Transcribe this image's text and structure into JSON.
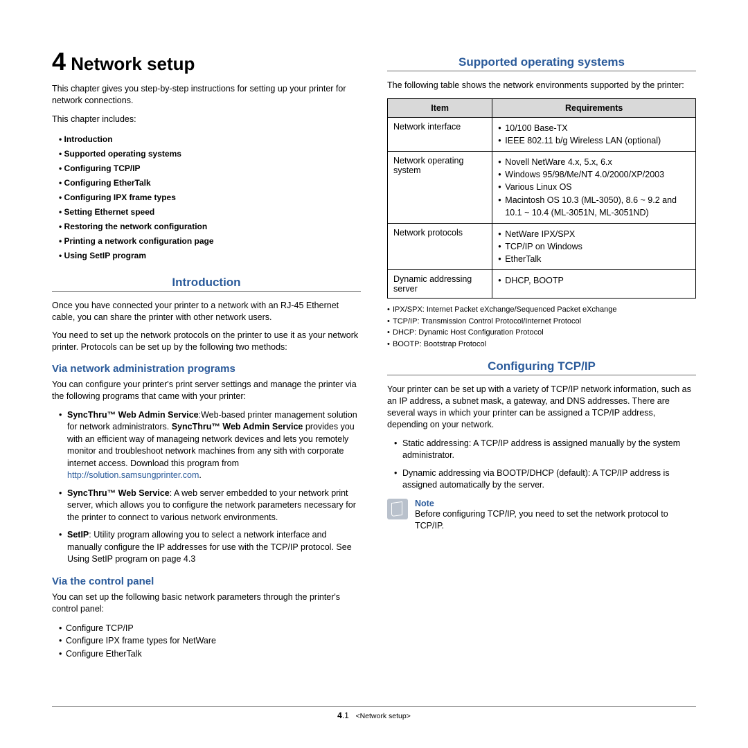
{
  "chapter": {
    "num": "4",
    "title": "Network setup"
  },
  "intro_para": "This chapter gives you step-by-step instructions for setting up your printer for network connections.",
  "includes_label": "This chapter includes:",
  "toc": [
    "Introduction",
    "Supported operating systems",
    "Configuring TCP/IP",
    "Configuring EtherTalk",
    "Configuring IPX frame types",
    "Setting Ethernet speed",
    "Restoring the network configuration",
    "Printing a network configuration page",
    "Using SetIP program"
  ],
  "sec_introduction": {
    "head": "Introduction",
    "p1": "Once you have connected your printer to a network with an RJ-45 Ethernet cable, you can share the printer with other network users.",
    "p2": "You need to set up the network protocols on the printer to use it as your network printer. Protocols can be set up by the following two methods:"
  },
  "sub_admin": {
    "head": "Via network administration programs",
    "intro": "You can configure your printer's print server settings and manage the printer via the following programs that came with your printer:",
    "items": {
      "a_bold1": "SyncThru™ Web Admin Service",
      "a_rest1": ":Web-based printer management solution for network administrators. ",
      "a_bold2": "SyncThru™ Web Admin Service",
      "a_rest2": " provides you with an efficient way of manageing network devices and lets you remotely monitor and troubleshoot network machines from any sith with corporate internet access. Download this program from ",
      "a_link": "http://solution.samsungprinter.com",
      "a_rest3": ".",
      "b_bold": "SyncThru™ Web Service",
      "b_rest": ": A web server embedded to your network print server, which allows you to configure the network parameters necessary for the printer to connect to various network environments.",
      "c_bold": "SetIP",
      "c_rest": ": Utility program allowing you to select a network interface and manually configure the IP addresses for use with the TCP/IP protocol. See Using SetIP program on page 4.3"
    }
  },
  "sub_panel": {
    "head": "Via the control panel",
    "intro": "You can set up the following basic network parameters through the printer's control panel:",
    "items": [
      "Configure TCP/IP",
      "Configure IPX frame types for NetWare",
      "Configure EtherTalk"
    ]
  },
  "sec_supported": {
    "head": "Supported operating systems",
    "intro": "The following table shows the network environments supported by the printer:",
    "th1": "Item",
    "th2": "Requirements",
    "rows": [
      {
        "item": "Network interface",
        "reqs": [
          "10/100 Base-TX",
          "IEEE 802.11 b/g Wireless LAN (optional)"
        ]
      },
      {
        "item": "Network operating system",
        "reqs": [
          "Novell NetWare 4.x, 5.x, 6.x",
          "Windows 95/98/Me/NT 4.0/2000/XP/2003",
          "Various Linux OS",
          "Macintosh OS 10.3 (ML-3050), 8.6 ~ 9.2 and 10.1 ~ 10.4 (ML-3051N, ML-3051ND)"
        ]
      },
      {
        "item": "Network protocols",
        "reqs": [
          "NetWare IPX/SPX",
          "TCP/IP on Windows",
          "EtherTalk"
        ]
      },
      {
        "item": "Dynamic addressing server",
        "reqs": [
          "DHCP, BOOTP"
        ]
      }
    ],
    "defs": [
      "IPX/SPX: Internet Packet eXchange/Sequenced Packet eXchange",
      "TCP/IP: Transmission Control Protocol/Internet Protocol",
      "DHCP: Dynamic Host Configuration Protocol",
      "BOOTP: Bootstrap Protocol"
    ]
  },
  "sec_tcpip": {
    "head": "Configuring TCP/IP",
    "p": "Your printer can be set up with a variety of TCP/IP network information, such as an IP address, a subnet mask, a gateway, and DNS addresses. There are several ways in which your printer can be assigned a TCP/IP address, depending on your network.",
    "items": [
      "Static addressing: A TCP/IP address is assigned manually by the system administrator.",
      "Dynamic addressing via BOOTP/DHCP (default): A TCP/IP address is assigned automatically by the server."
    ],
    "note_label": "Note",
    "note_text": "Before configuring TCP/IP, you need to set the network protocol to TCP/IP."
  },
  "footer": {
    "page_num_bold": "4",
    "page_num_rest": ".1",
    "crumb": "<Network setup>"
  }
}
